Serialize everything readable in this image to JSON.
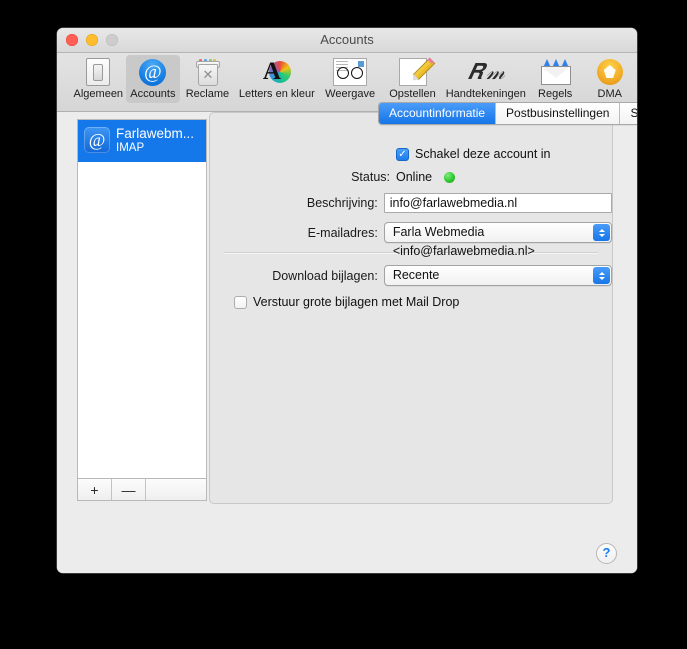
{
  "window": {
    "title": "Accounts",
    "traffic_lights": [
      "close",
      "minimize",
      "zoom"
    ]
  },
  "toolbar": {
    "items": [
      {
        "label": "Algemeen",
        "icon": "general-switch-icon",
        "selected": false
      },
      {
        "label": "Accounts",
        "icon": "at-sign-icon",
        "selected": true
      },
      {
        "label": "Reclame",
        "icon": "trash-junk-icon",
        "selected": false
      },
      {
        "label": "Letters en kleur",
        "icon": "fonts-colors-icon",
        "selected": false
      },
      {
        "label": "Weergave",
        "icon": "viewing-glasses-icon",
        "selected": false
      },
      {
        "label": "Opstellen",
        "icon": "compose-pencil-icon",
        "selected": false
      },
      {
        "label": "Handtekeningen",
        "icon": "signature-icon",
        "selected": false
      },
      {
        "label": "Regels",
        "icon": "rules-envelope-icon",
        "selected": false
      },
      {
        "label": "DMA",
        "icon": "dma-badge-icon",
        "selected": false
      }
    ]
  },
  "accounts_list": {
    "items": [
      {
        "name": "Farlawebm...",
        "protocol": "IMAP",
        "icon": "at-sign-icon",
        "selected": true
      }
    ],
    "add_label": "+",
    "remove_label": "—"
  },
  "tabs": [
    {
      "label": "Accountinformatie",
      "active": true
    },
    {
      "label": "Postbusinstellingen",
      "active": false
    },
    {
      "label": "Serverinstellingen",
      "active": false
    }
  ],
  "account_info": {
    "enable_checkbox": {
      "label": "Schakel deze account in",
      "checked": true,
      "check_glyph": "✓"
    },
    "status": {
      "label": "Status:",
      "value": "Online",
      "dot_color": "#2fc72f"
    },
    "description": {
      "label": "Beschrijving:",
      "value": "info@farlawebmedia.nl"
    },
    "email": {
      "label": "E-mailadres:",
      "value": "Farla Webmedia <info@farlawebmedia.nl>"
    },
    "download_attachments": {
      "label": "Download bijlagen:",
      "value": "Recente"
    },
    "mail_drop": {
      "label": "Verstuur grote bijlagen met Mail Drop",
      "checked": false
    }
  },
  "help": {
    "label": "?"
  }
}
